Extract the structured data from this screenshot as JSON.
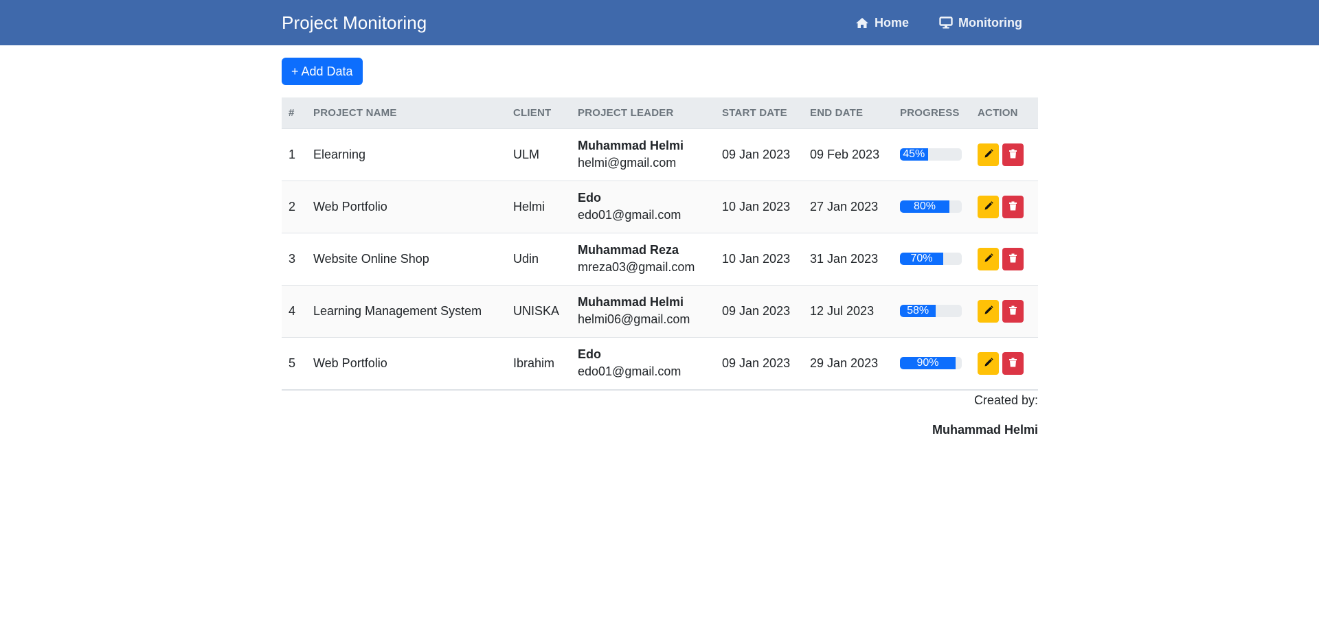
{
  "navbar": {
    "brand": "Project Monitoring",
    "links": [
      {
        "label": "Home",
        "icon": "home-icon"
      },
      {
        "label": "Monitoring",
        "icon": "monitor-icon"
      }
    ]
  },
  "toolbar": {
    "add_label": "+ Add Data"
  },
  "table": {
    "headers": [
      "#",
      "PROJECT NAME",
      "CLIENT",
      "PROJECT LEADER",
      "START DATE",
      "END DATE",
      "PROGRESS",
      "ACTION"
    ],
    "rows": [
      {
        "no": "1",
        "project": "Elearning",
        "client": "ULM",
        "leader_name": "Muhammad Helmi",
        "leader_email": "helmi@gmail.com",
        "start": "09 Jan 2023",
        "end": "09 Feb 2023",
        "progress": 45,
        "progress_label": "45%"
      },
      {
        "no": "2",
        "project": "Web Portfolio",
        "client": "Helmi",
        "leader_name": "Edo",
        "leader_email": "edo01@gmail.com",
        "start": "10 Jan 2023",
        "end": "27 Jan 2023",
        "progress": 80,
        "progress_label": "80%"
      },
      {
        "no": "3",
        "project": "Website Online Shop",
        "client": "Udin",
        "leader_name": "Muhammad Reza",
        "leader_email": "mreza03@gmail.com",
        "start": "10 Jan 2023",
        "end": "31 Jan 2023",
        "progress": 70,
        "progress_label": "70%"
      },
      {
        "no": "4",
        "project": "Learning Management System",
        "client": "UNISKA",
        "leader_name": "Muhammad Helmi",
        "leader_email": "helmi06@gmail.com",
        "start": "09 Jan 2023",
        "end": "12 Jul 2023",
        "progress": 58,
        "progress_label": "58%"
      },
      {
        "no": "5",
        "project": "Web Portfolio",
        "client": "Ibrahim",
        "leader_name": "Edo",
        "leader_email": "edo01@gmail.com",
        "start": "09 Jan 2023",
        "end": "29 Jan 2023",
        "progress": 90,
        "progress_label": "90%"
      }
    ]
  },
  "actions": {
    "edit_icon": "pencil-icon",
    "delete_icon": "trash-icon"
  },
  "footer": {
    "created_label": "Created by:",
    "author": "Muhammad Helmi"
  },
  "colors": {
    "navbar": "#3f69ab",
    "primary": "#0d6efd",
    "warning": "#ffc107",
    "danger": "#dc3545"
  }
}
